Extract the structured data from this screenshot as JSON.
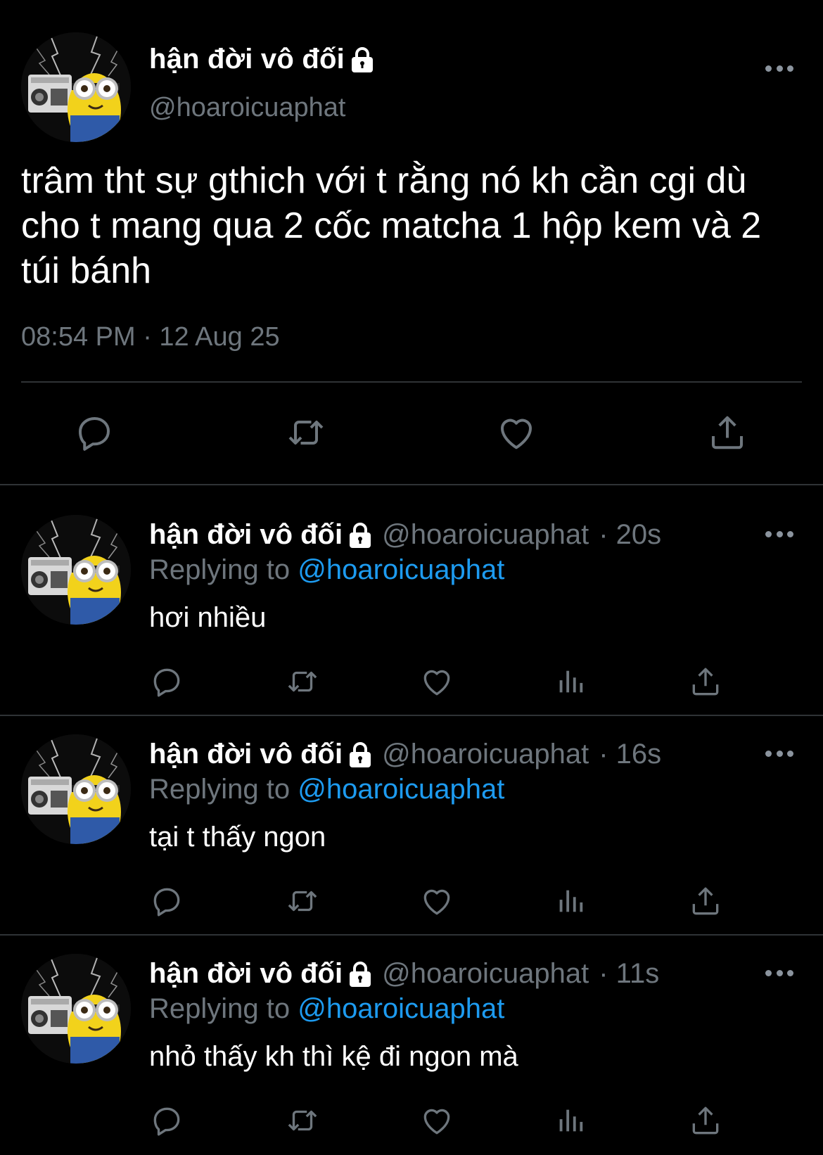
{
  "main_tweet": {
    "display_name": "hận đời vô đối",
    "handle": "@hoaroicuaphat",
    "text": "trâm tht sự gthich với t rằng nó kh cần cgi dù cho t mang qua 2 cốc matcha 1 hộp kem và 2 túi bánh",
    "timestamp": "08:54 PM · 12 Aug 25"
  },
  "replies": [
    {
      "display_name": "hận đời vô đối",
      "handle": "@hoaroicuaphat",
      "time": "· 20s",
      "replying_prefix": "Replying to",
      "replying_handle": "@hoaroicuaphat",
      "text": "hơi nhiều"
    },
    {
      "display_name": "hận đời vô đối",
      "handle": "@hoaroicuaphat",
      "time": "· 16s",
      "replying_prefix": "Replying to",
      "replying_handle": "@hoaroicuaphat",
      "text": "tại t thấy ngon"
    },
    {
      "display_name": "hận đời vô đối",
      "handle": "@hoaroicuaphat",
      "time": "· 11s",
      "replying_prefix": "Replying to",
      "replying_handle": "@hoaroicuaphat",
      "text": "nhỏ thấy kh thì kệ đi ngon mà"
    }
  ],
  "icons": {
    "lock": "lock-icon",
    "more": "more-icon",
    "reply": "reply-icon",
    "retweet": "retweet-icon",
    "like": "like-icon",
    "views": "views-icon",
    "share": "share-icon"
  },
  "colors": {
    "background": "#000000",
    "text": "#ffffff",
    "muted": "#6e767d",
    "link": "#1d9bf0",
    "divider": "#2f3336"
  }
}
